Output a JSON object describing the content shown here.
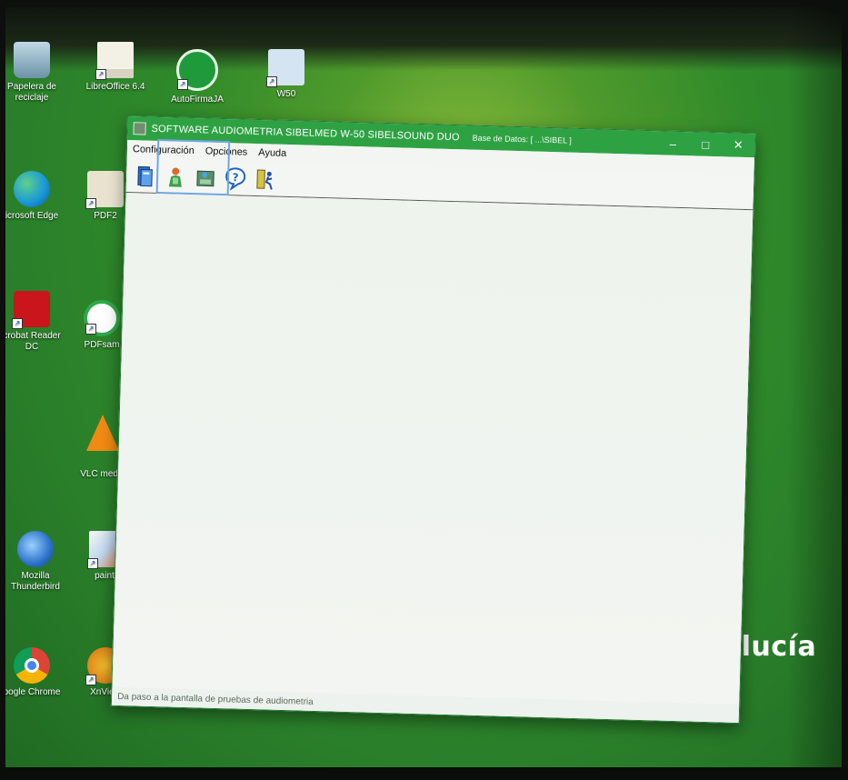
{
  "desktop": {
    "icons": [
      {
        "label": "Papelera de reciclaje",
        "icon": "recycle-bin-icon"
      },
      {
        "label": "LibreOffice 6.4",
        "icon": "libreoffice-icon"
      },
      {
        "label": "AutoFirmaJA",
        "icon": "autofirma-icon"
      },
      {
        "label": "W50",
        "icon": "w50-icon"
      },
      {
        "label": "icrosoft Edge",
        "icon": "edge-icon"
      },
      {
        "label": "PDF2",
        "icon": "pdf24-icon"
      },
      {
        "label": "crobat Reader DC",
        "icon": "acrobat-icon"
      },
      {
        "label": "PDFsam",
        "icon": "pdfsam-icon"
      },
      {
        "label": "VLC media",
        "icon": "vlc-icon"
      },
      {
        "label": "Mozilla Thunderbird",
        "icon": "thunderbird-icon"
      },
      {
        "label": "paint.r",
        "icon": "paint-icon"
      },
      {
        "label": "oogle Chrome",
        "icon": "chrome-icon"
      },
      {
        "label": "XnView",
        "icon": "xnview-icon"
      }
    ],
    "wallpaper_text": "alucía"
  },
  "window": {
    "title": "SOFTWARE AUDIOMETRIA SIBELMED W-50  SIBELSOUND DUO",
    "db_info": "Base de Datos: [ ...\\SIBEL ]",
    "controls": {
      "minimize": "–",
      "maximize": "□",
      "close": "✕"
    },
    "menu": [
      "Configuración",
      "Opciones",
      "Ayuda"
    ],
    "toolbar": [
      {
        "icon": "database-icon"
      },
      {
        "icon": "patient-icon"
      },
      {
        "icon": "audiometry-test-icon"
      },
      {
        "icon": "help-icon"
      },
      {
        "icon": "exit-icon"
      }
    ],
    "status": "Da paso a la pantalla de pruebas de audiometria"
  },
  "colors": {
    "titlebar": "#2ea243",
    "highlight": "#6fa6e8",
    "wallpaper": "#2f8a2a"
  }
}
